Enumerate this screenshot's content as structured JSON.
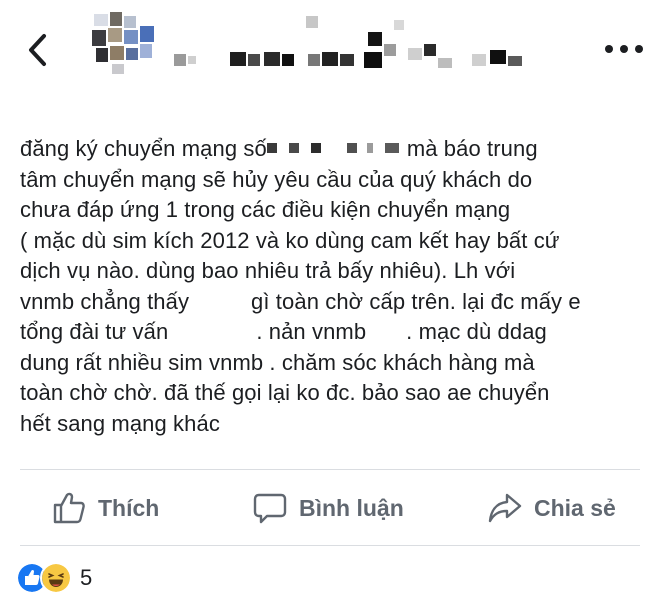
{
  "post": {
    "lines": [
      {
        "before": "đăng ký chuyển mạng số",
        "after": "mà báo trung"
      },
      {
        "text": "tâm chuyển mạng sẽ hủy yêu cầu của quý khách do"
      },
      {
        "text": "chưa đáp ứng 1 trong các điều kiện chuyển mạng"
      },
      {
        "text": "( mặc dù sim kích 2012 và ko dùng cam kết hay bất cứ"
      },
      {
        "text": "dịch vụ nào. dùng bao nhiêu trả bấy nhiêu). Lh với"
      },
      {
        "before": "vnmb chẳng thấy",
        "after": "gì toàn chờ cấp trên. lại đc mấy e"
      },
      {
        "before": "tổng đài tư vấn",
        "middle": ". nản vnmb",
        "after": ". mạc dù ddag"
      },
      {
        "text": "dung rất nhiều sim vnmb . chăm sóc khách hàng mà"
      },
      {
        "text": "toàn chờ chờ. đã thế gọi lại ko đc. bảo sao ae chuyển"
      },
      {
        "text": "hết sang mạng khác"
      }
    ]
  },
  "actions": {
    "like_label": "Thích",
    "comment_label": "Bình luận",
    "share_label": "Chia sẻ"
  },
  "reactions": {
    "icons": [
      "like-reaction-icon",
      "haha-reaction-icon"
    ],
    "count": "5"
  },
  "colors": {
    "action_text": "#606770",
    "like_blue": "#1877f2",
    "haha_yellow": "#f7c843",
    "divider": "#dadde1"
  }
}
